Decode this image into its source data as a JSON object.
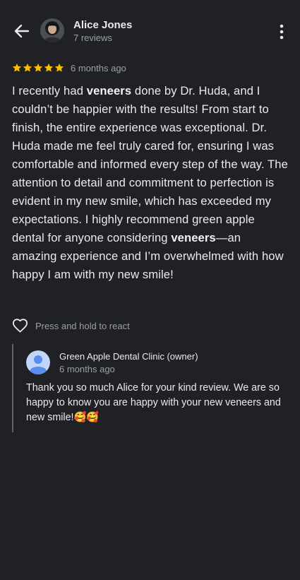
{
  "header": {
    "author_name": "Alice Jones",
    "author_meta": "7 reviews"
  },
  "review": {
    "rating": 5,
    "date": "6 months ago",
    "text_parts": [
      {
        "text": "I recently had ",
        "bold": false
      },
      {
        "text": "veneers",
        "bold": true
      },
      {
        "text": " done by Dr. Huda, and I couldn’t be happier with the results! From start to finish, the entire experience was exceptional. Dr. Huda made me feel truly cared for, ensuring I was comfortable and informed every step of the way. The attention to detail and commitment to perfection is evident in my new smile, which has exceeded my expectations. I highly recommend green apple dental for anyone considering ",
        "bold": false
      },
      {
        "text": "veneers",
        "bold": true
      },
      {
        "text": "—an amazing experience and I’m overwhelmed with how happy I am with my new smile!",
        "bold": false
      }
    ]
  },
  "react": {
    "label": "Press and hold to react"
  },
  "owner_reply": {
    "name": "Green Apple Dental Clinic (owner)",
    "date": "6 months ago",
    "text": "Thank you so much Alice for your kind review. We are so happy to know you are happy with your new veneers and new smile!🥰🥰"
  },
  "icons": {
    "back": "arrow-back-icon",
    "more": "more-vert-icon",
    "star": "star-icon",
    "heart": "heart-outline-icon",
    "owner_avatar": "person-avatar-icon"
  },
  "colors": {
    "background": "#202124",
    "star": "#fbbc04",
    "text": "#e8eaed",
    "muted": "#9aa0a6",
    "owner_avatar_bg": "#c2d7f7",
    "owner_avatar_fg": "#5b8def"
  }
}
